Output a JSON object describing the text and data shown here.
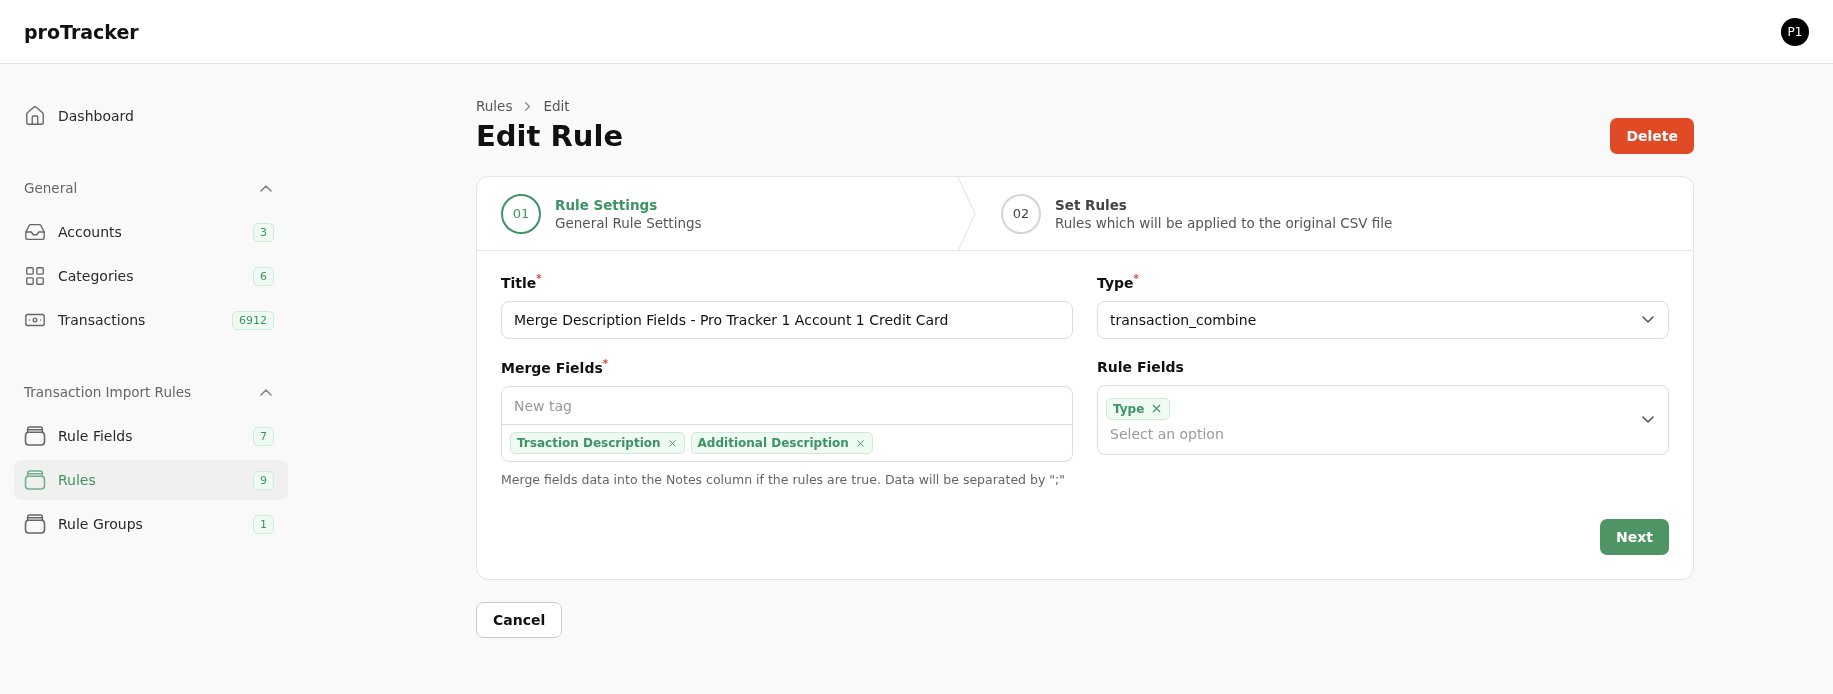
{
  "app": {
    "brand": "proTracker",
    "avatar": "P1"
  },
  "sidebar": {
    "top": [
      {
        "label": "Dashboard",
        "selected": false
      }
    ],
    "sections": [
      {
        "title": "General",
        "expanded": true,
        "items": [
          {
            "label": "Accounts",
            "badge": "3",
            "selected": false
          },
          {
            "label": "Categories",
            "badge": "6",
            "selected": false
          },
          {
            "label": "Transactions",
            "badge": "6912",
            "selected": false
          }
        ]
      },
      {
        "title": "Transaction Import Rules",
        "expanded": true,
        "items": [
          {
            "label": "Rule Fields",
            "badge": "7",
            "selected": false
          },
          {
            "label": "Rules",
            "badge": "9",
            "selected": true
          },
          {
            "label": "Rule Groups",
            "badge": "1",
            "selected": false
          }
        ]
      }
    ]
  },
  "breadcrumb": [
    "Rules",
    "Edit"
  ],
  "page_title": "Edit Rule",
  "delete_button": "Delete",
  "steps": [
    {
      "number": "01",
      "title": "Rule Settings",
      "subtitle": "General Rule Settings",
      "selected": true
    },
    {
      "number": "02",
      "title": "Set Rules",
      "subtitle": "Rules which will be applied to the original CSV file",
      "selected": false
    }
  ],
  "form": {
    "title": {
      "label": "Title$^{*}$",
      "value": "Merge Description Fields - Pro Tracker 1 Account 1 Credit Card"
    },
    "type": {
      "label": "Type$^{*}$",
      "value": "transaction_combine"
    },
    "merge_fields": {
      "label": "Merge Fields$^{*}$",
      "placeholder": "New tag",
      "tags": [
        "Trsaction Description",
        "Additional Description"
      ],
      "help": "Merge fields data into the Notes column if the rules are true. Data will be separated by \";\""
    },
    "rule_fields": {
      "label": "Rule Fields",
      "tags": [
        "Type"
      ],
      "placeholder": "Select an option"
    }
  },
  "next_button": "Next",
  "cancel_button": "Cancel"
}
